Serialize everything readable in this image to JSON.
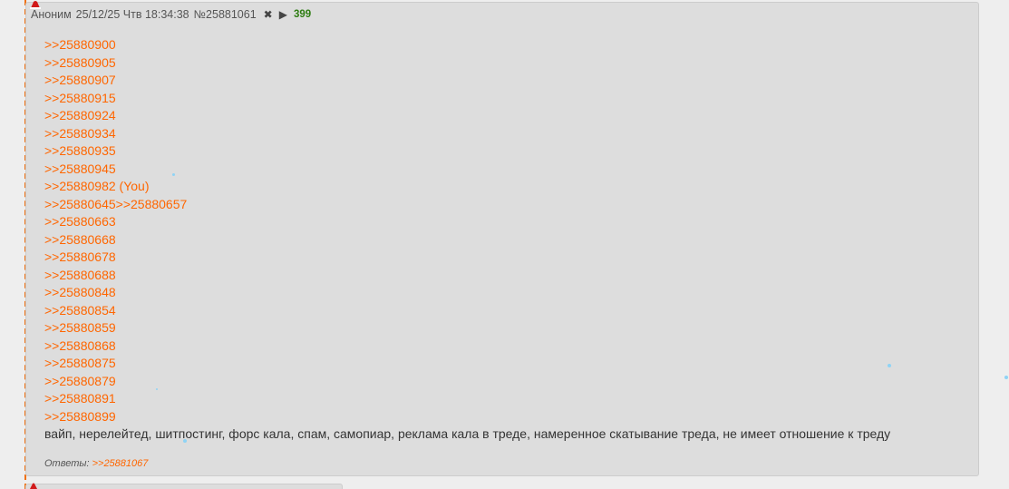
{
  "post": {
    "author": "Аноним",
    "date": "25/12/25 Чтв 18:34:38",
    "number": "№25881061",
    "hide_icon": "close-icon",
    "play_icon": "play-icon",
    "reply_count": "399",
    "replies": [
      ">>25880900",
      ">>25880905",
      ">>25880907",
      ">>25880915",
      ">>25880924",
      ">>25880934",
      ">>25880935",
      ">>25880945",
      ">>25880982 (You)",
      ">>25880645>>25880657",
      ">>25880663",
      ">>25880668",
      ">>25880678",
      ">>25880688",
      ">>25880848",
      ">>25880854",
      ">>25880859",
      ">>25880868",
      ">>25880875",
      ">>25880879",
      ">>25880891",
      ">>25880899"
    ],
    "message": "вайп, нерелейтед, шитпостинг, форс кала, спам, самопиар, реклама кала в треде, намеренное скатывание треда, не имеет отношение к треду",
    "answers_label": "Ответы:",
    "answers_link": ">>25881067"
  },
  "colors": {
    "link": "#ff6600",
    "count": "#2e7d12",
    "post_bg": "#dddddd",
    "page_bg": "#eeeeee"
  }
}
